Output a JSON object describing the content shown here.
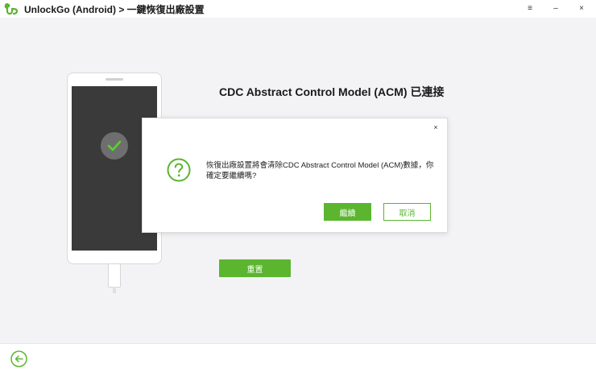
{
  "titlebar": {
    "app_name": "UnlockGo (Android) > 一鍵恢復出廠設置",
    "menu_icon": "≡",
    "minimize_icon": "–",
    "close_icon": "×"
  },
  "main": {
    "heading": "CDC Abstract Control Model (ACM) 已連接",
    "reset_label": "重置"
  },
  "dialog": {
    "close_icon": "×",
    "message": "恢復出廠設置將會清除CDC Abstract Control Model (ACM)數據，你確定要繼續嗎?",
    "continue_label": "繼續",
    "cancel_label": "取消"
  },
  "colors": {
    "accent": "#5bb52f",
    "screen": "#3a3a3a",
    "background": "#f3f3f5"
  }
}
